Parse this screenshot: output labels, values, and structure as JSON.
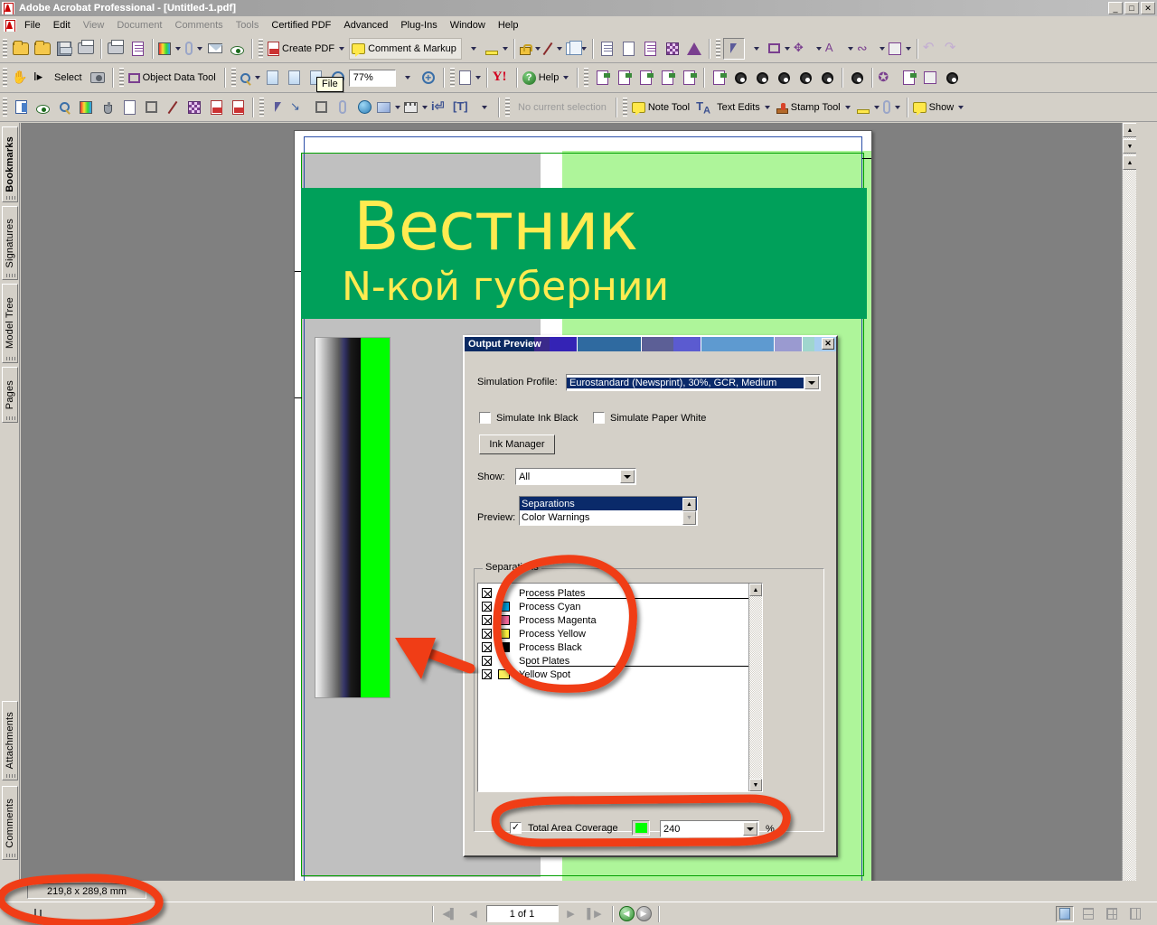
{
  "window": {
    "title": "Adobe Acrobat Professional - [Untitled-1.pdf]",
    "app_icon": "acrobat-icon",
    "minimize_label": "_",
    "maximize_label": "□",
    "close_label": "✕"
  },
  "menubar": {
    "items": [
      {
        "label": "File",
        "enabled": true
      },
      {
        "label": "Edit",
        "enabled": true
      },
      {
        "label": "View",
        "enabled": false
      },
      {
        "label": "Document",
        "enabled": true
      },
      {
        "label": "Comments",
        "enabled": true
      },
      {
        "label": "Tools",
        "enabled": true
      },
      {
        "label": "Certified PDF",
        "enabled": true
      },
      {
        "label": "Advanced",
        "enabled": true
      },
      {
        "label": "Plug-Ins",
        "enabled": true
      },
      {
        "label": "Window",
        "enabled": true
      },
      {
        "label": "Help",
        "enabled": true
      }
    ]
  },
  "toolbar_file": {
    "buttons": [
      {
        "name": "open-button",
        "icon": "open-folder-icon"
      },
      {
        "name": "organizer-button",
        "icon": "organizer-folder-icon"
      },
      {
        "name": "save-button",
        "icon": "floppy-disk-icon"
      },
      {
        "name": "print-button",
        "icon": "printer-icon"
      },
      {
        "name": "print-production-button",
        "icon": "press-icon"
      },
      {
        "name": "export-button",
        "icon": "export-up-arrow-icon"
      },
      {
        "name": "organizer-dropdown",
        "icon": "card-file-icon"
      },
      {
        "name": "attach-dropdown",
        "icon": "paperclip-icon"
      },
      {
        "name": "email-button",
        "icon": "email-globe-icon"
      },
      {
        "name": "search-button",
        "icon": "binoculars-icon"
      }
    ],
    "create_pdf_label": "Create PDF",
    "comment_markup_label": "Comment & Markup"
  },
  "toolbar_basic": {
    "hand_tool": "hand-tool-icon",
    "select_label": "Select",
    "snapshot_icon": "snapshot-camera-icon",
    "object_data_tool_label": "Object Data Tool",
    "zoom_icon": "zoom-in-magnifier-icon",
    "zoom_out_icon": "zoom-out-icon",
    "zoom_in_icon": "zoom-in-icon",
    "zoom_value": "77%",
    "yahoo_icon": "yahoo-icon",
    "help_label": "Help"
  },
  "toolbar_markup": {
    "no_selection_label": "No current selection",
    "note_tool_label": "Note Tool",
    "text_edits_label": "Text Edits",
    "stamp_tool_label": "Stamp Tool",
    "show_label": "Show"
  },
  "tooltip": {
    "text": "File"
  },
  "navigation_tabs": [
    {
      "label": "Bookmarks",
      "selected": true
    },
    {
      "label": "Signatures",
      "selected": false
    },
    {
      "label": "Model Tree",
      "selected": false
    },
    {
      "label": "Pages",
      "selected": false
    },
    {
      "label": "Attachments",
      "selected": false
    },
    {
      "label": "Comments",
      "selected": false
    }
  ],
  "document": {
    "masthead_title": "Вестник",
    "masthead_subtitle": "N-кой губернии",
    "masthead_bg_color": "#00a05a",
    "masthead_text_color": "#ffeb50",
    "tint_color": "#aef59a",
    "spot_green_color": "#00ff00"
  },
  "dialog": {
    "title": "Output Preview",
    "close_label": "✕",
    "simulation_profile_label": "Simulation Profile:",
    "simulation_profile_value": "Eurostandard (Newsprint), 30%, GCR, Medium",
    "simulate_ink_black_label": "Simulate Ink Black",
    "simulate_ink_black_checked": false,
    "simulate_paper_white_label": "Simulate Paper White",
    "simulate_paper_white_checked": false,
    "ink_manager_label": "Ink Manager",
    "show_label": "Show:",
    "show_value": "All",
    "preview_label": "Preview:",
    "preview_options": [
      {
        "label": "Separations",
        "selected": true
      },
      {
        "label": "Color Warnings",
        "selected": false
      }
    ],
    "separations_group_label": "Separations",
    "separations": [
      {
        "name": "Process Plates",
        "checked": true,
        "swatch": null,
        "is_header": true
      },
      {
        "name": "Process Cyan",
        "checked": true,
        "swatch": "#00aeef",
        "is_header": false
      },
      {
        "name": "Process Magenta",
        "checked": true,
        "swatch": "#f4689b",
        "is_header": false
      },
      {
        "name": "Process Yellow",
        "checked": true,
        "swatch": "#fff33f",
        "is_header": false
      },
      {
        "name": "Process Black",
        "checked": true,
        "swatch": "#000000",
        "is_header": false
      },
      {
        "name": "Spot Plates",
        "checked": true,
        "swatch": null,
        "is_header": true
      },
      {
        "name": "Yellow Spot",
        "checked": true,
        "swatch": "#fbee5d",
        "is_header": false
      }
    ],
    "total_area_coverage_label": "Total Area Coverage",
    "total_area_coverage_checked": true,
    "total_area_coverage_swatch": "#00ff00",
    "total_area_coverage_value": "240",
    "total_area_coverage_unit": "%"
  },
  "statusbar": {
    "page_size": "219,8 x 289,8 mm"
  },
  "navbar": {
    "first_page_icon": "first-page-icon",
    "prev_page_icon": "previous-page-icon",
    "page_value": "1 of 1",
    "next_page_icon": "next-page-icon",
    "last_page_icon": "last-page-icon",
    "back_icon": "go-back-icon",
    "forward_icon": "go-forward-icon",
    "layout_single": "single-page-layout-icon",
    "layout_continuous": "continuous-layout-icon",
    "layout_facing": "facing-pages-layout-icon",
    "layout_continuous_facing": "continuous-facing-layout-icon"
  },
  "annotations": {
    "marker_color": "#f03c14",
    "shapes": [
      "ellipse-around-separations-list",
      "arrow-to-green-bar",
      "ellipse-around-total-area-coverage",
      "ellipse-around-page-size"
    ]
  }
}
